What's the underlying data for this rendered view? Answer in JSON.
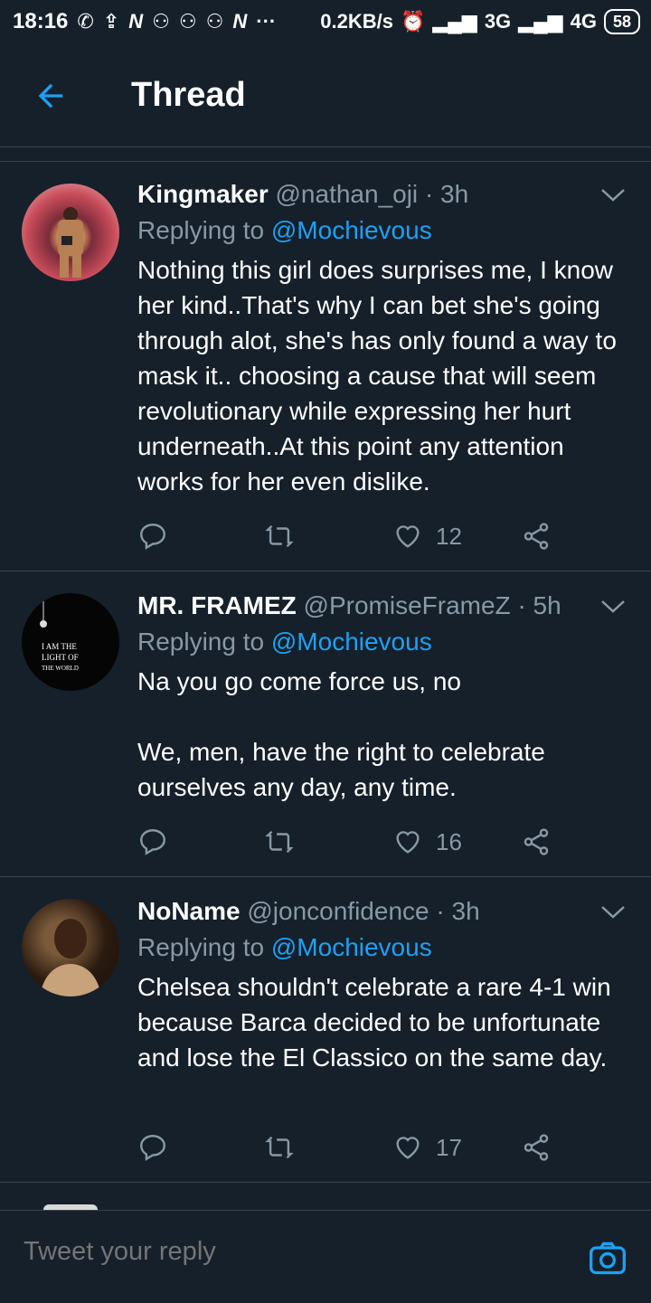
{
  "status_bar": {
    "time": "18:16",
    "net_speed": "0.2KB/s",
    "net1": "3G",
    "net2": "4G",
    "battery": "58"
  },
  "header": {
    "title": "Thread"
  },
  "colors": {
    "background": "#15202b",
    "accent": "#1da1f2",
    "muted": "#8899a6",
    "divider": "#38444d"
  },
  "tweets": [
    {
      "name": "Kingmaker",
      "handle": "@nathan_oji",
      "time": "· 3h",
      "replying_prefix": "Replying to",
      "replying_to": "@Mochievous",
      "body": "Nothing this girl does surprises me, I know her kind..That's why I can bet she's going through alot, she's has only found a way to mask it.. choosing a cause that will seem revolutionary while expressing her hurt underneath..At this point any attention works for her even dislike.",
      "likes": "12"
    },
    {
      "name": "MR. FRAMEZ",
      "handle": "@PromiseFrameZ",
      "time": "· 5h",
      "replying_prefix": "Replying to",
      "replying_to": "@Mochievous",
      "body": "Na you go come force us, no\n\nWe, men, have the right to celebrate ourselves any day, any time.",
      "likes": "16",
      "avatar_text": "I AM THE LIGHT OF THE WORLD"
    },
    {
      "name": "NoName",
      "handle": "@jonconfidence",
      "time": "· 3h",
      "replying_prefix": "Replying to",
      "replying_to": "@Mochievous",
      "body": "Chelsea shouldn't celebrate a rare 4-1 win because Barca decided to be unfortunate and lose the El Classico on the same day.",
      "likes": "17"
    }
  ],
  "composer": {
    "placeholder": "Tweet your reply"
  }
}
